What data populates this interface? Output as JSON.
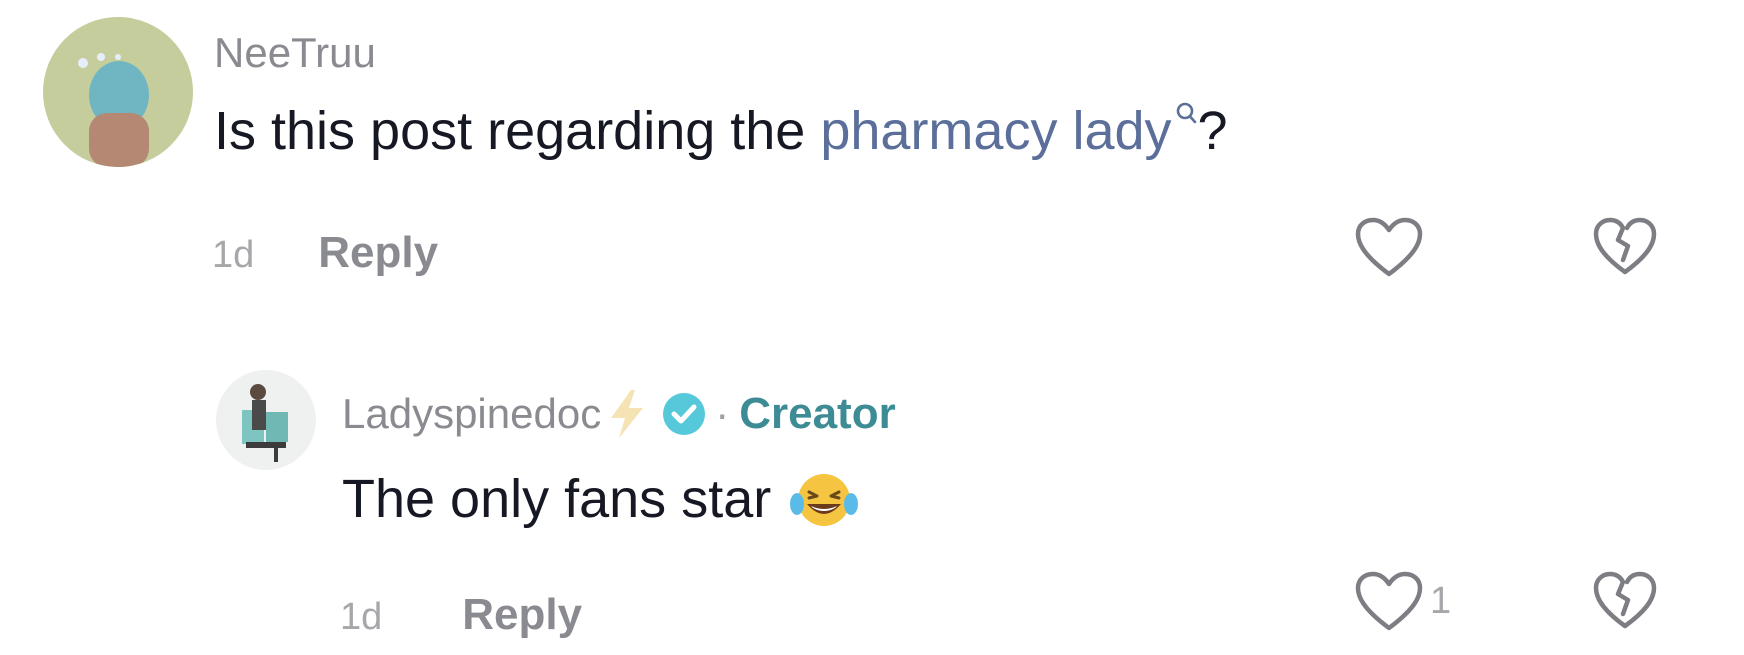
{
  "comments": [
    {
      "username": "NeeTruu",
      "text_before": "Is this post regarding the ",
      "mention": "pharmacy lady",
      "text_after": "?",
      "time": "1d",
      "reply_label": "Reply",
      "like_count": ""
    },
    {
      "username": "Ladyspinedoc",
      "badge_label": "Creator",
      "badge_separator": "·",
      "text": "The only fans star",
      "emoji": "face-with-tears-of-joy",
      "time": "1d",
      "reply_label": "Reply",
      "like_count": "1"
    }
  ],
  "colors": {
    "mention": "#5b6f9a",
    "creator": "#3d8c95",
    "verified": "#55c8da",
    "muted": "#8a8b91"
  }
}
